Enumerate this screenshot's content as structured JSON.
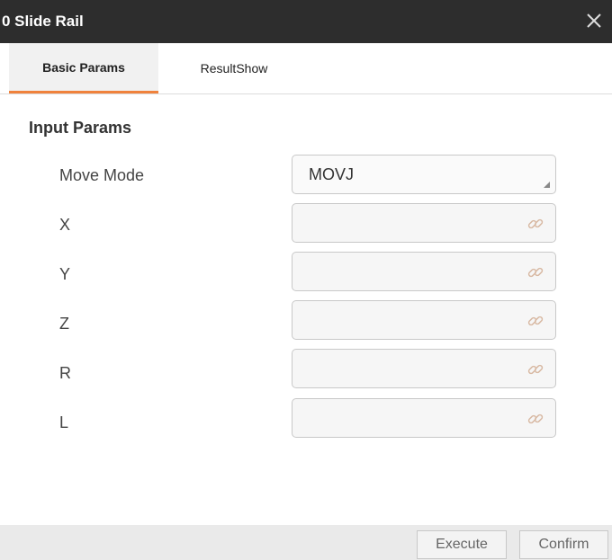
{
  "window": {
    "title": "0 Slide Rail"
  },
  "tabs": [
    {
      "label": "Basic Params",
      "active": true
    },
    {
      "label": "ResultShow",
      "active": false
    }
  ],
  "section": {
    "title": "Input Params"
  },
  "fields": {
    "move_mode": {
      "label": "Move Mode",
      "value": "MOVJ"
    },
    "x": {
      "label": "X",
      "value": ""
    },
    "y": {
      "label": "Y",
      "value": ""
    },
    "z": {
      "label": "Z",
      "value": ""
    },
    "r": {
      "label": "R",
      "value": ""
    },
    "l": {
      "label": "L",
      "value": ""
    }
  },
  "buttons": {
    "execute": "Execute",
    "confirm": "Confirm"
  },
  "colors": {
    "titlebar": "#2d2d2d",
    "accent": "#f0823c"
  },
  "icons": {
    "close": "close-icon",
    "link": "link-icon",
    "dropdown": "dropdown-corner-icon"
  }
}
